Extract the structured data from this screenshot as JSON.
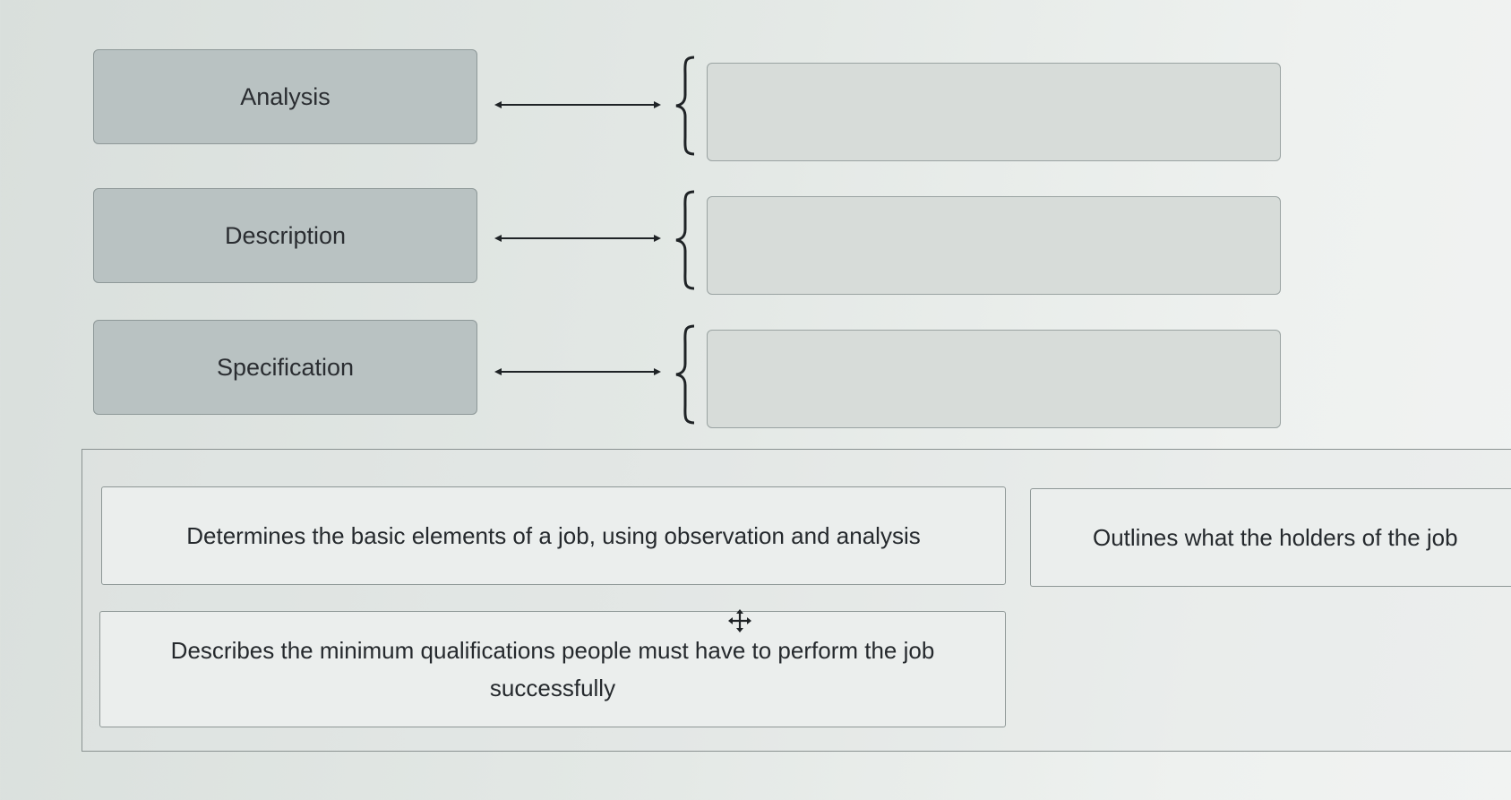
{
  "terms": [
    {
      "label": "Analysis"
    },
    {
      "label": "Description"
    },
    {
      "label": "Specification"
    }
  ],
  "answer_cards": [
    {
      "text": "Determines the basic elements of a job, using observation and analysis"
    },
    {
      "text": "Outlines what the holders of the job"
    },
    {
      "text": "Describes the minimum qualifications people must have to perform the job successfully"
    }
  ],
  "icons": {
    "connector": "double-arrow-icon",
    "bracket": "curly-brace-icon",
    "cursor": "move-cursor-icon"
  },
  "colors": {
    "term_fill": "#b9c2c2",
    "drop_fill": "#d7dcd9",
    "card_fill": "#ebeeed",
    "text": "#2a2d31"
  }
}
